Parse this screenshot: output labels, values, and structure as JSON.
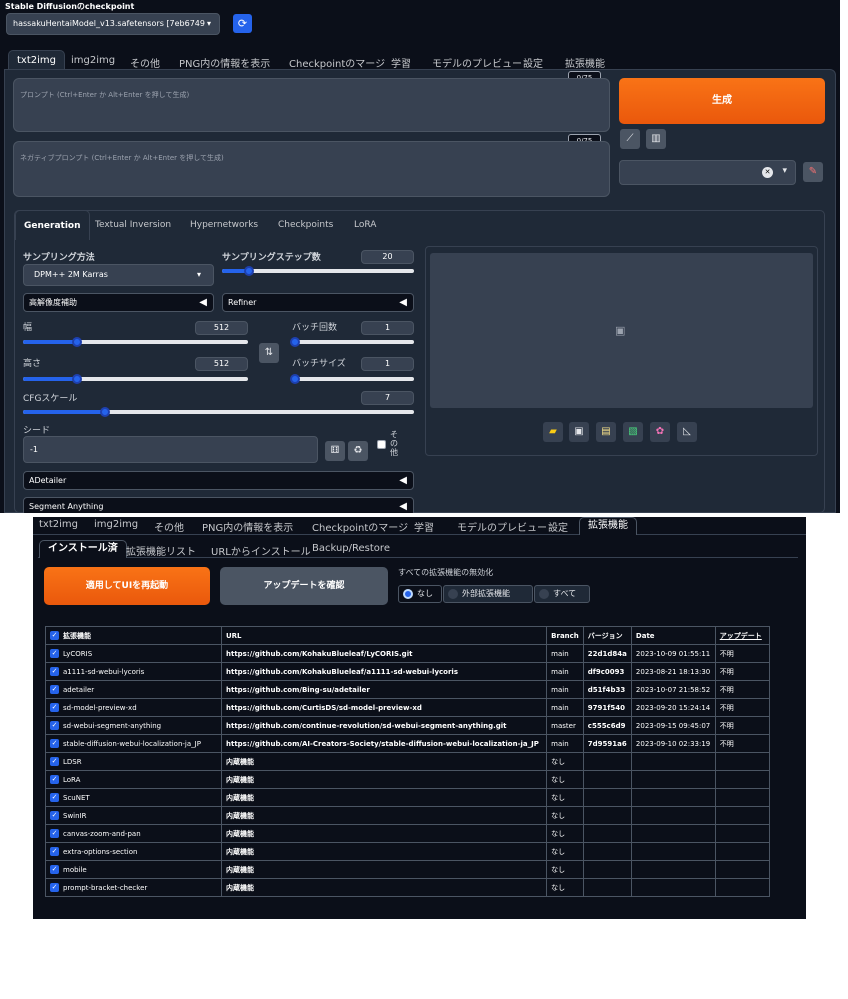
{
  "header": {
    "checkpoint_label": "Stable Diffusionのcheckpoint",
    "checkpoint_value": "hassakuHentaiModel_v13.safetensors [7eb6749",
    "refresh_icon": "refresh-icon"
  },
  "main_tabs": [
    "txt2img",
    "img2img",
    "その他",
    "PNG内の情報を表示",
    "Checkpointのマージ",
    "学習",
    "モデルのプレビュー",
    "設定",
    "拡張機能"
  ],
  "prompt": {
    "counter": "0/75",
    "placeholder": "プロンプト (Ctrl+Enter か Alt+Enter を押して生成)"
  },
  "negative_prompt": {
    "counter": "0/75",
    "placeholder": "ネガティブプロンプト (Ctrl+Enter か Alt+Enter を押して生成)"
  },
  "generate_label": "生成",
  "sub_tabs": [
    "Generation",
    "Textual Inversion",
    "Hypernetworks",
    "Checkpoints",
    "LoRA"
  ],
  "generation": {
    "sampler_label": "サンプリング方法",
    "sampler_value": "DPM++ 2M Karras",
    "steps_label": "サンプリングステップ数",
    "steps_value": "20",
    "steps_fraction": 0.14,
    "hires_label": "高解像度補助",
    "refiner_label": "Refiner",
    "width_label": "幅",
    "width_value": "512",
    "width_fraction": 0.24,
    "height_label": "高さ",
    "height_value": "512",
    "height_fraction": 0.24,
    "batch_count_label": "バッチ回数",
    "batch_count_value": "1",
    "batch_size_label": "バッチサイズ",
    "batch_size_value": "1",
    "cfg_label": "CFGスケール",
    "cfg_value": "7",
    "cfg_fraction": 0.21,
    "seed_label": "シード",
    "seed_value": "-1",
    "other_label": "その他",
    "adetailer_label": "ADetailer",
    "segment_label": "Segment Anything"
  },
  "ext_tabs": [
    "txt2img",
    "img2img",
    "その他",
    "PNG内の情報を表示",
    "Checkpointのマージ",
    "学習",
    "モデルのプレビュー",
    "設定",
    "拡張機能"
  ],
  "ext_subtabs": [
    "インストール済",
    "拡張機能リスト",
    "URLからインストール",
    "Backup/Restore"
  ],
  "apply_label": "適用してUIを再起動",
  "check_update_label": "アップデートを確認",
  "disable_all_label": "すべての拡張機能の無効化",
  "radio_options": [
    "なし",
    "外部拡張機能",
    "すべて"
  ],
  "table_headers": [
    "拡張機能",
    "URL",
    "Branch",
    "バージョン",
    "Date",
    "アップデート"
  ],
  "extensions": [
    [
      "LyCORIS",
      "https://github.com/KohakuBlueleaf/LyCORIS.git",
      "main",
      "22d1d84a",
      "2023-10-09 01:55:11",
      "不明"
    ],
    [
      "a1111-sd-webui-lycoris",
      "https://github.com/KohakuBlueleaf/a1111-sd-webui-lycoris",
      "main",
      "df9c0093",
      "2023-08-21 18:13:30",
      "不明"
    ],
    [
      "adetailer",
      "https://github.com/Bing-su/adetailer",
      "main",
      "d51f4b33",
      "2023-10-07 21:58:52",
      "不明"
    ],
    [
      "sd-model-preview-xd",
      "https://github.com/CurtisDS/sd-model-preview-xd",
      "main",
      "9791f540",
      "2023-09-20 15:24:14",
      "不明"
    ],
    [
      "sd-webui-segment-anything",
      "https://github.com/continue-revolution/sd-webui-segment-anything.git",
      "master",
      "c555c6d9",
      "2023-09-15 09:45:07",
      "不明"
    ],
    [
      "stable-diffusion-webui-localization-ja_JP",
      "https://github.com/AI-Creators-Society/stable-diffusion-webui-localization-ja_JP",
      "main",
      "7d9591a6",
      "2023-09-10 02:33:19",
      "不明"
    ],
    [
      "LDSR",
      "内蔵機能",
      "なし",
      "",
      "",
      ""
    ],
    [
      "LoRA",
      "内蔵機能",
      "なし",
      "",
      "",
      ""
    ],
    [
      "ScuNET",
      "内蔵機能",
      "なし",
      "",
      "",
      ""
    ],
    [
      "SwinIR",
      "内蔵機能",
      "なし",
      "",
      "",
      ""
    ],
    [
      "canvas-zoom-and-pan",
      "内蔵機能",
      "なし",
      "",
      "",
      ""
    ],
    [
      "extra-options-section",
      "内蔵機能",
      "なし",
      "",
      "",
      ""
    ],
    [
      "mobile",
      "内蔵機能",
      "なし",
      "",
      "",
      ""
    ],
    [
      "prompt-bracket-checker",
      "内蔵機能",
      "なし",
      "",
      "",
      ""
    ]
  ],
  "colors": {
    "accent": "#ea580c",
    "bg": "#0b0f19",
    "panel": "#1f2937",
    "checkbox": "#2563eb"
  }
}
